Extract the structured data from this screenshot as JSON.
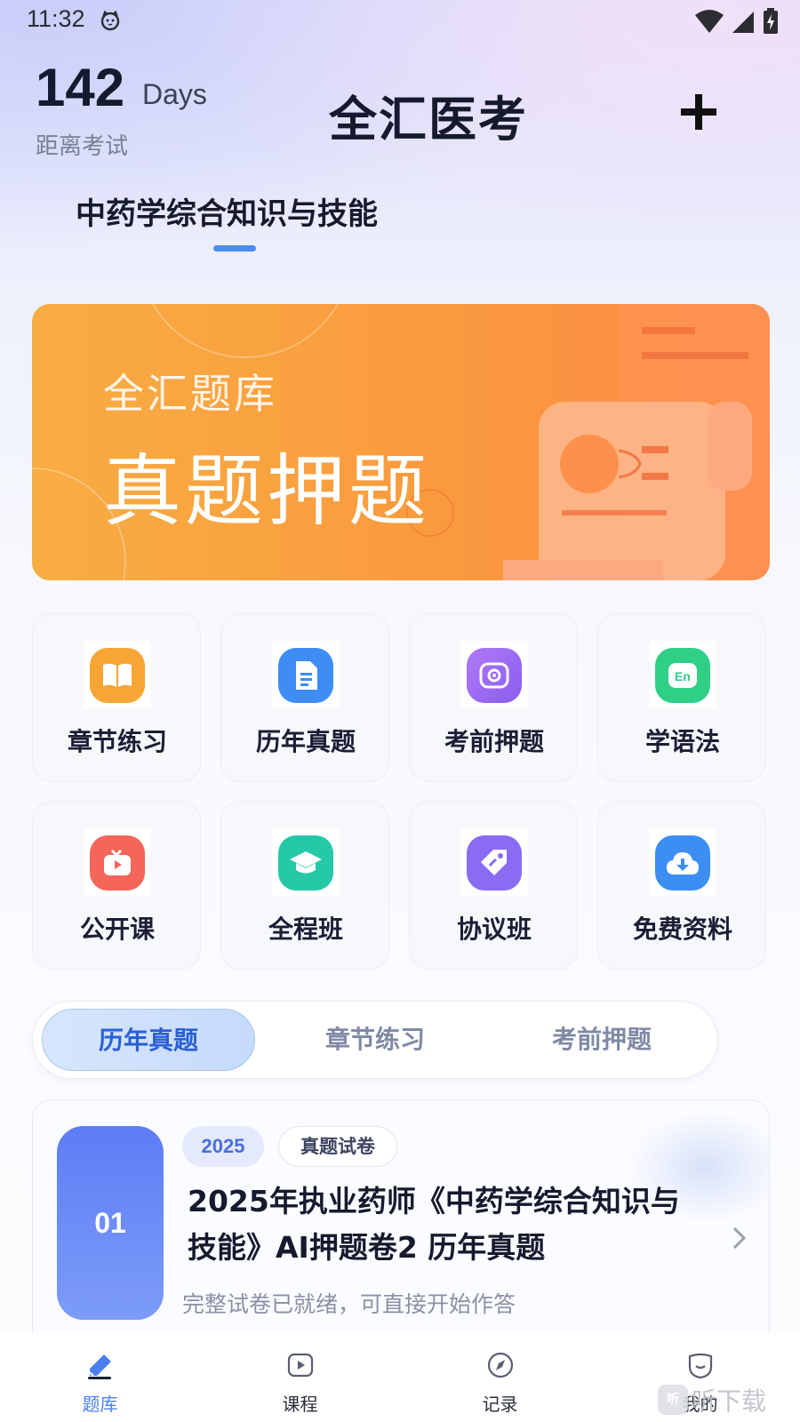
{
  "status_bar": {
    "time": "11:32"
  },
  "header": {
    "days_count": "142",
    "days_unit": "Days",
    "days_caption": "距离考试",
    "app_title": "全汇医考",
    "subject": "中药学综合知识与技能"
  },
  "banner": {
    "subtitle": "全汇题库",
    "title": "真题押题"
  },
  "grid": {
    "items": [
      {
        "label": "章节练习",
        "icon": "book-icon",
        "color": "#f7a534"
      },
      {
        "label": "历年真题",
        "icon": "document-icon",
        "color": "#3e8df5"
      },
      {
        "label": "考前押题",
        "icon": "target-icon",
        "color": "#9b62f0"
      },
      {
        "label": "学语法",
        "icon": "en-icon",
        "color": "#2fcf86"
      },
      {
        "label": "公开课",
        "icon": "tv-icon",
        "color": "#f5665a"
      },
      {
        "label": "全程班",
        "icon": "graduation-cap-icon",
        "color": "#25c9a7"
      },
      {
        "label": "协议班",
        "icon": "tag-icon",
        "color": "#8a6cf3"
      },
      {
        "label": "免费资料",
        "icon": "cloud-download-icon",
        "color": "#3d8ef3"
      }
    ]
  },
  "segment_tabs": {
    "items": [
      {
        "label": "历年真题",
        "active": true
      },
      {
        "label": "章节练习",
        "active": false
      },
      {
        "label": "考前押题",
        "active": false
      }
    ]
  },
  "paper_card": {
    "index": "01",
    "year_badge": "2025",
    "type_badge": "真题试卷",
    "title": "2025年执业药师《中药学综合知识与技能》AI押题卷2 历年真题",
    "description": "完整试卷已就绪，可直接开始作答"
  },
  "bottom_nav": {
    "items": [
      {
        "label": "题库",
        "icon": "pencil-icon",
        "active": true
      },
      {
        "label": "课程",
        "icon": "play-icon",
        "active": false
      },
      {
        "label": "记录",
        "icon": "compass-icon",
        "active": false
      },
      {
        "label": "我的",
        "icon": "profile-icon",
        "active": false
      }
    ]
  },
  "watermark": {
    "badge": "听",
    "text": "听下载"
  },
  "colors": {
    "accent": "#4a8ef2",
    "banner_start": "#f8ad43",
    "banner_end": "#fd8a47",
    "active_tab_text": "#2b5fd6"
  }
}
